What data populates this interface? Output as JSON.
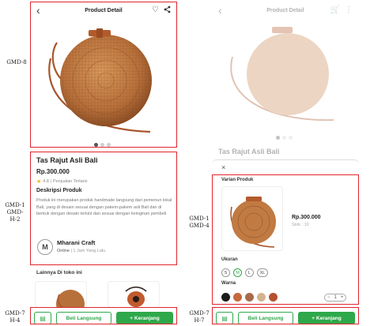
{
  "labels": {
    "gmd8": "GMD-8",
    "gmd1_gmd_h2_line1": "GMD-1",
    "gmd1_gmd_h2_line2": "GMD-",
    "gmd1_gmd_h2_line3": "H-2",
    "gmd7_h4_line1": "GMD-7",
    "gmd7_h4_line2": "H-4",
    "gmd1_gmd4_line1": "GMD-1",
    "gmd1_gmd4_line2": "GMD-4",
    "gmd7_h7_line1": "GMD-7",
    "gmd7_h7_line2": "H-7"
  },
  "left": {
    "header_title": "Product Detail",
    "product_name": "Tas Rajut Asli Bali",
    "price": "Rp.300.000",
    "rating": "4.8",
    "rating_extra": "| Penjualan Terlaris",
    "desc_title": "Deskripsi Produk",
    "desc_text": "Produk ini merupakan produk handmade langsung dari pemenun lokal Bali, yang di desain sesuai dengan pakem-pakem asli Bali dan di bentuk dengan desain terkini dan sesuai dengan keinginan pembeli",
    "seller_initial": "M",
    "seller_name": "Mharani Craft",
    "seller_status_online": "Online",
    "seller_status_time": "| 1 Jam Yang Lalu",
    "others_title": "Lainnya Di toko ini",
    "buy_label": "Beli Langsung",
    "cart_label": "+ Keranjang"
  },
  "right": {
    "header_title": "Product Detail",
    "product_name": "Tas Rajut Asli Bali",
    "close": "×",
    "variant_title": "Varian Produk",
    "price": "Rp.300.000",
    "stock": "Stok : 10",
    "size_title": "Ukuran",
    "sizes": [
      "S",
      "M",
      "L",
      "XL"
    ],
    "color_title": "Warna",
    "colors": [
      "#1a1a1a",
      "#c46a3c",
      "#a86b4a",
      "#d3b38f",
      "#b5502f"
    ],
    "qty": "1",
    "qty_minus": "−",
    "qty_plus": "+",
    "buy_label": "Beli Langsung",
    "cart_label": "+ Keranjang"
  }
}
